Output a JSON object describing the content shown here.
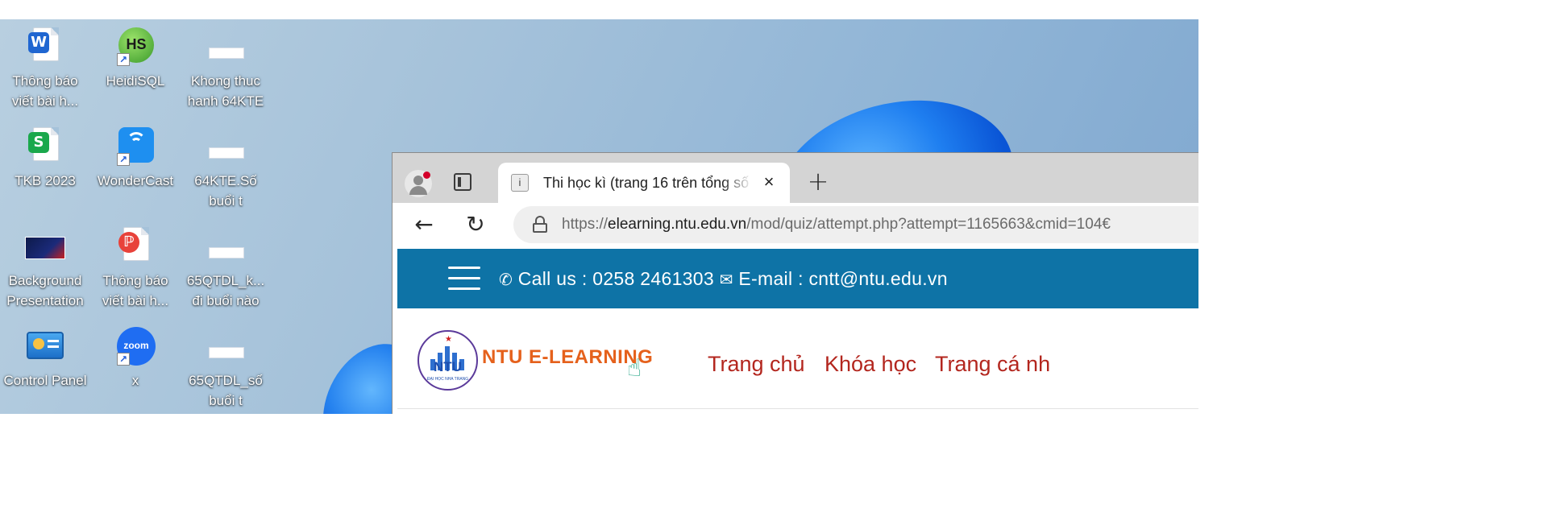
{
  "desktop": {
    "icons": [
      {
        "label": "Thông báo\nviết bài h...",
        "icon": "word-document-icon"
      },
      {
        "label": "HeidiSQL",
        "icon": "heidisql-icon"
      },
      {
        "label": "Khong thuc\nhanh 64KTE",
        "icon": "blank-file-icon"
      },
      {
        "label": "TKB 2023",
        "icon": "spreadsheet-icon"
      },
      {
        "label": "WonderCast",
        "icon": "wondercast-icon"
      },
      {
        "label": "64KTE.Số\nbuổi t",
        "icon": "blank-file-icon"
      },
      {
        "label": "Background\nPresentation",
        "icon": "presentation-thumbnail-icon"
      },
      {
        "label": "Thông báo\nviết bài h...",
        "icon": "pdf-document-icon"
      },
      {
        "label": "65QTDL_k...\nđi buổi nào",
        "icon": "blank-file-icon"
      },
      {
        "label": "Control Panel",
        "icon": "control-panel-icon"
      },
      {
        "label": "x",
        "icon": "zoom-icon"
      },
      {
        "label": "65QTDL_số\nbuổi t",
        "icon": "blank-file-icon"
      }
    ],
    "icon_texts": {
      "word_glyph": "W",
      "heidi_glyph": "HS",
      "sheet_glyph": "S",
      "zoom_glyph": "zoom"
    }
  },
  "browser": {
    "tab_title": "Thi học kì (trang 16 trên tổng số",
    "tab_close": "×",
    "new_tab": "+",
    "back_glyph": "←",
    "reload_glyph": "↻",
    "url_prefix": "https://",
    "url_host": "elearning.ntu.edu.vn",
    "url_path": "/mod/quiz/attempt.php?attempt=1165663&cmid=104€"
  },
  "site": {
    "contact_call": "Call us : 0258 2461303",
    "contact_email": "E-mail : cntt@ntu.edu.vn",
    "logo_abbr": "NTU",
    "logo_sub": "ĐẠI HỌC NHA TRANG",
    "logo_text": "NTU E-LEARNING",
    "menu": [
      "Trang chủ",
      "Khóa học",
      "Trang cá nh"
    ],
    "colors": {
      "topbar": "#0e73a6",
      "menu_link": "#b3261e",
      "logo_text": "#e5611c"
    }
  }
}
